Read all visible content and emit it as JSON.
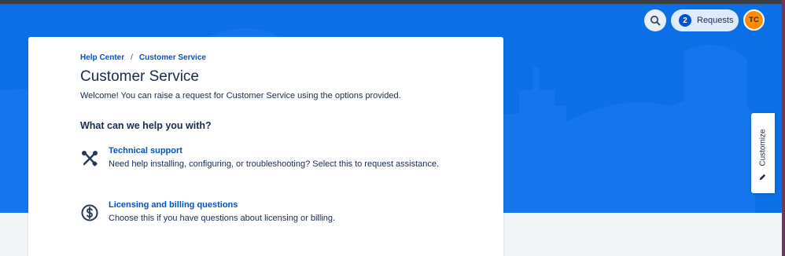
{
  "breadcrumb": {
    "home": "Help Center",
    "separator": "/",
    "current": "Customer Service"
  },
  "portal": {
    "title": "Customer Service",
    "welcome": "Welcome! You can raise a request for Customer Service using the options provided.",
    "section_heading": "What can we help you with?"
  },
  "options": [
    {
      "title": "Technical support",
      "description": "Need help installing, configuring, or troubleshooting? Select this to request assistance.",
      "icon": "wrench-screwdriver-icon"
    },
    {
      "title": "Licensing and billing questions",
      "description": "Choose this if you have questions about licensing or billing.",
      "icon": "dollar-coin-icon"
    }
  ],
  "header": {
    "search_icon": "search-icon",
    "requests_count": "2",
    "requests_label": "Requests",
    "avatar_initials": "TC"
  },
  "customize": {
    "label": "Customize",
    "icon": "pencil-icon"
  },
  "colors": {
    "banner": "#0b6fe6",
    "link": "#0052cc",
    "avatar": "#ff8b00",
    "text": "#172b4d"
  }
}
